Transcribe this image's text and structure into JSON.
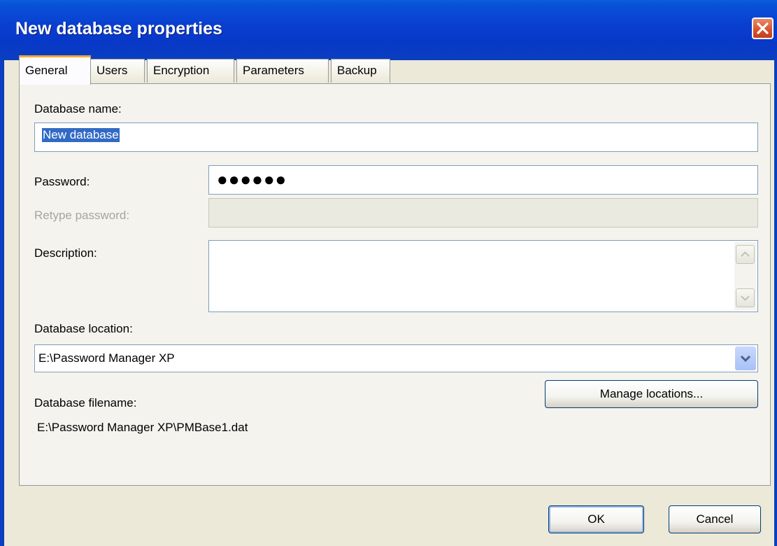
{
  "window": {
    "title": "New database properties",
    "close_icon": "close-icon"
  },
  "tabs": [
    {
      "label": "General",
      "active": true
    },
    {
      "label": "Users",
      "active": false
    },
    {
      "label": "Encryption",
      "active": false
    },
    {
      "label": "Parameters",
      "active": false
    },
    {
      "label": "Backup",
      "active": false
    }
  ],
  "general": {
    "database_name_label": "Database name:",
    "database_name_value": "New database",
    "password_label": "Password:",
    "password_value": "●●●●●●",
    "retype_password_label": "Retype password:",
    "retype_password_value": "",
    "description_label": "Description:",
    "description_value": "",
    "location_label": "Database location:",
    "location_value": "E:\\Password Manager XP",
    "manage_locations_label": "Manage locations...",
    "filename_label": "Database filename:",
    "filename_value": "E:\\Password Manager XP\\PMBase1.dat"
  },
  "buttons": {
    "ok_label": "OK",
    "cancel_label": "Cancel"
  },
  "colors": {
    "titlebar": "#0a3fbf",
    "active_tab_accent": "#f1a93b",
    "selection": "#316ac5"
  }
}
